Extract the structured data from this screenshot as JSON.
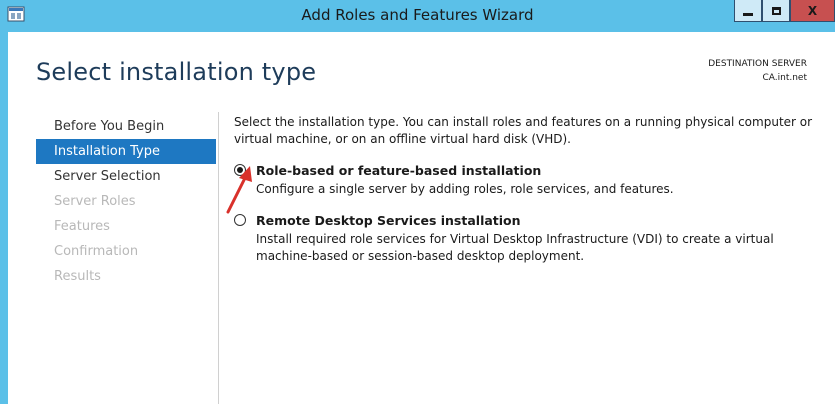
{
  "window": {
    "title": "Add Roles and Features Wizard",
    "controls": {
      "minimize": "minimize",
      "maximize": "maximize",
      "close": "X"
    },
    "accent_color": "#5bc0e8"
  },
  "header": {
    "title": "Select installation type",
    "destination_label": "DESTINATION SERVER",
    "destination_value": "CA.int.net"
  },
  "nav": {
    "items": [
      {
        "label": "Before You Begin",
        "state": "normal"
      },
      {
        "label": "Installation Type",
        "state": "active"
      },
      {
        "label": "Server Selection",
        "state": "normal"
      },
      {
        "label": "Server Roles",
        "state": "disabled"
      },
      {
        "label": "Features",
        "state": "disabled"
      },
      {
        "label": "Confirmation",
        "state": "disabled"
      },
      {
        "label": "Results",
        "state": "disabled"
      }
    ],
    "active_color": "#1e78c2"
  },
  "content": {
    "intro": "Select the installation type. You can install roles and features on a running physical computer or virtual machine, or on an offline virtual hard disk (VHD).",
    "options": [
      {
        "title": "Role-based or feature-based installation",
        "description": "Configure a single server by adding roles, role services, and features.",
        "selected": true
      },
      {
        "title": "Remote Desktop Services installation",
        "description": "Install required role services for Virtual Desktop Infrastructure (VDI) to create a virtual machine-based or session-based desktop deployment.",
        "selected": false
      }
    ]
  },
  "annotation": {
    "arrow_color": "#d9312b"
  }
}
